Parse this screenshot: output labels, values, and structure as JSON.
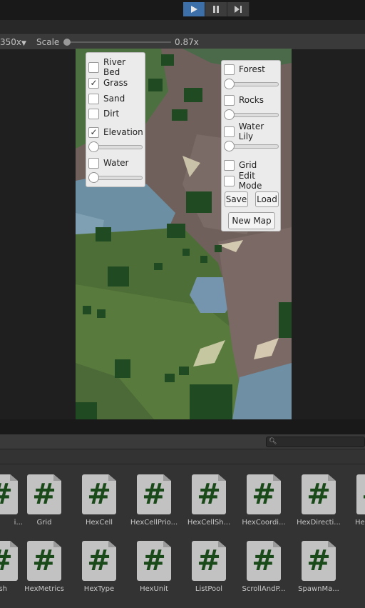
{
  "playmode": {
    "buttons": [
      {
        "icon": "play-icon",
        "active": true
      },
      {
        "icon": "pause-icon",
        "active": false
      },
      {
        "icon": "step-icon",
        "active": false
      }
    ]
  },
  "gameview": {
    "resolution_label": "350x",
    "scale_label": "Scale",
    "scale_value": "0.87x",
    "scale_fraction": 0.0
  },
  "left_panel": {
    "river_bed": {
      "label": "River Bed",
      "checked": false
    },
    "grass": {
      "label": "Grass",
      "checked": true
    },
    "sand": {
      "label": "Sand",
      "checked": false
    },
    "dirt": {
      "label": "Dirt",
      "checked": false
    },
    "elevation": {
      "label": "Elevation",
      "checked": true,
      "slider": 0.0
    },
    "water": {
      "label": "Water",
      "checked": false,
      "slider": 0.0
    }
  },
  "right_panel": {
    "forest": {
      "label": "Forest",
      "checked": false,
      "slider": 0.0
    },
    "rocks": {
      "label": "Rocks",
      "checked": false,
      "slider": 0.0
    },
    "water_lily": {
      "label": "Water Lily",
      "checked": false,
      "slider": 0.0
    },
    "grid": {
      "label": "Grid",
      "checked": false
    },
    "edit_mode": {
      "label": "Edit Mode",
      "checked": false
    },
    "save_label": "Save",
    "load_label": "Load",
    "new_map_label": "New Map"
  },
  "project": {
    "search_placeholder": "",
    "assets_row1": [
      "i...",
      "Grid",
      "HexCell",
      "HexCellPrio...",
      "HexCellSh...",
      "HexCoordi...",
      "HexDirecti...",
      "He"
    ],
    "assets_row2": [
      "sh",
      "HexMetrics",
      "HexType",
      "HexUnit",
      "ListPool",
      "ScrollAndP...",
      "SpawnMa..."
    ]
  },
  "colors": {
    "accent": "#3d6fa8",
    "script_icon": "#c2c2c2",
    "script_hash": "#1a4a1a"
  }
}
